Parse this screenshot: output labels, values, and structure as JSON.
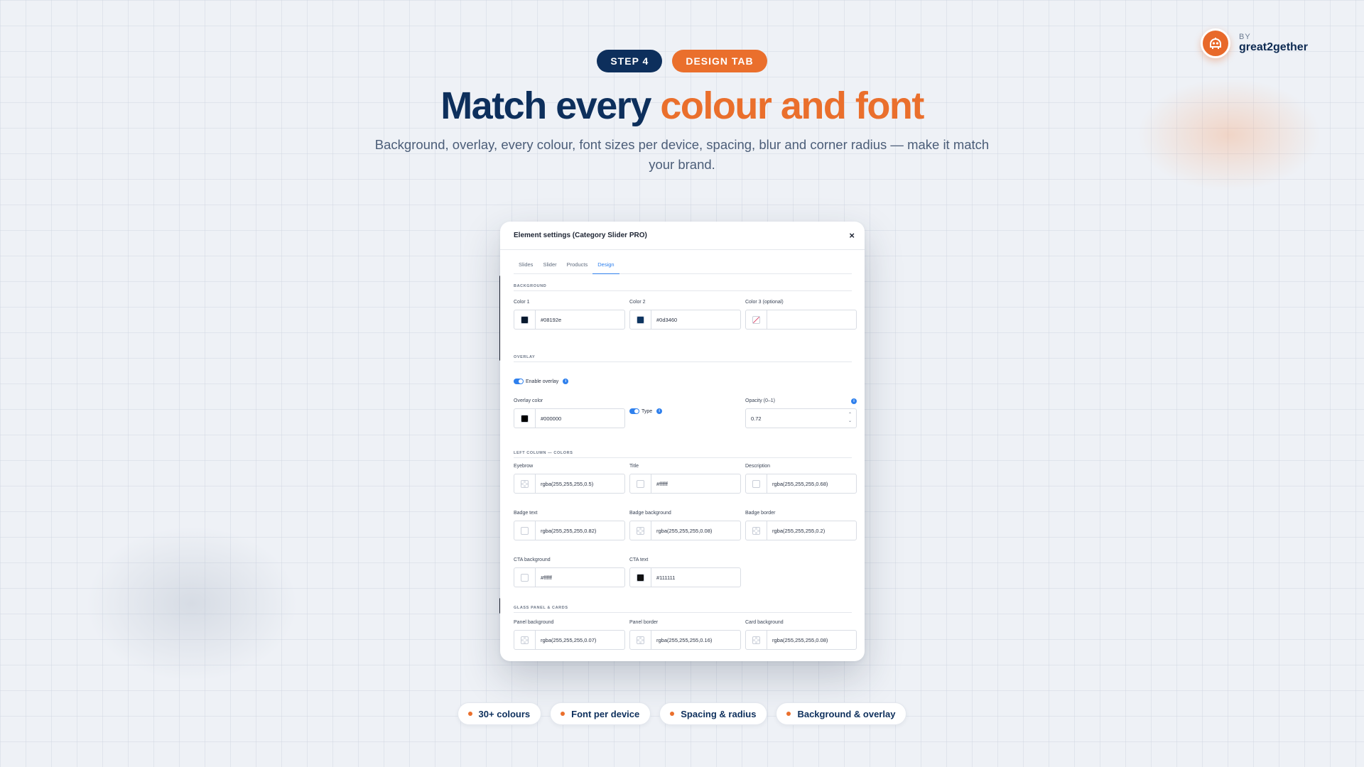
{
  "brand": {
    "by": "BY",
    "name": "great2gether"
  },
  "header": {
    "step_label": "STEP 4",
    "tab_label": "DESIGN TAB",
    "headline_main": "Match every ",
    "headline_accent": "colour and font",
    "subhead": "Background, overlay, every colour, font sizes per device, spacing, blur and corner radius — make it match your brand."
  },
  "colors": {
    "navy": "#0d2f5c",
    "orange": "#ea6f2c",
    "link_blue": "#2f80ed"
  },
  "dialog": {
    "title": "Element settings (Category Slider PRO)",
    "close": "×",
    "tabs": [
      {
        "label": "Slides"
      },
      {
        "label": "Slider"
      },
      {
        "label": "Products"
      },
      {
        "label": "Design",
        "active": true
      }
    ],
    "background": {
      "section": "BACKGROUND",
      "color1": {
        "label": "Color 1",
        "value": "#08192e"
      },
      "color2": {
        "label": "Color 2",
        "value": "#0d3460"
      },
      "color3": {
        "label": "Color 3 (optional)",
        "value": ""
      }
    },
    "overlay": {
      "section": "OVERLAY",
      "enable_label": "Enable overlay",
      "color": {
        "label": "Overlay color",
        "value": "#000000"
      },
      "type_label": "Type",
      "opacity": {
        "label": "Opacity (0–1)",
        "value": "0.72"
      }
    },
    "left_column": {
      "section": "LEFT COLUMN — COLORS",
      "fields": [
        {
          "label": "Eyebrow",
          "value": "rgba(255,255,255,0.5)",
          "swatch": "checker"
        },
        {
          "label": "Title",
          "value": "#ffffff",
          "swatch": "#ffffff"
        },
        {
          "label": "Description",
          "value": "rgba(255,255,255,0.68)",
          "swatch": "#ffffff"
        },
        {
          "label": "Badge text",
          "value": "rgba(255,255,255,0.82)",
          "swatch": "#ffffff"
        },
        {
          "label": "Badge background",
          "value": "rgba(255,255,255,0.08)",
          "swatch": "checker"
        },
        {
          "label": "Badge border",
          "value": "rgba(255,255,255,0.2)",
          "swatch": "checker"
        },
        {
          "label": "CTA background",
          "value": "#ffffff",
          "swatch": "#ffffff"
        },
        {
          "label": "CTA text",
          "value": "#111111",
          "swatch": "#111111"
        }
      ]
    },
    "glass": {
      "section": "GLASS PANEL & CARDS",
      "fields": [
        {
          "label": "Panel background",
          "value": "rgba(255,255,255,0.07)",
          "swatch": "checker"
        },
        {
          "label": "Panel border",
          "value": "rgba(255,255,255,0.16)",
          "swatch": "checker"
        },
        {
          "label": "Card background",
          "value": "rgba(255,255,255,0.08)",
          "swatch": "checker"
        }
      ]
    }
  },
  "features": [
    {
      "label": "30+ colours"
    },
    {
      "label": "Font per device"
    },
    {
      "label": "Spacing & radius"
    },
    {
      "label": "Background & overlay"
    }
  ]
}
